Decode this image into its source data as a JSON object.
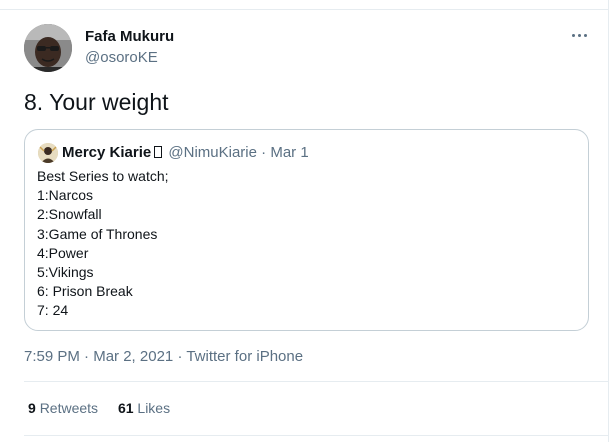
{
  "author": {
    "name": "Fafa Mukuru",
    "handle": "@osoroKE"
  },
  "tweet": {
    "text": "8. Your weight"
  },
  "quoted_tweet": {
    "author_name": "Mercy Kiarie",
    "handle": "@NimuKiarie",
    "separator": "·",
    "date": "Mar 1",
    "lines": [
      "Best Series to watch;",
      "1:Narcos",
      "2:Snowfall",
      "3:Game of Thrones",
      "4:Power",
      "5:Vikings",
      "6: Prison Break",
      "7: 24"
    ]
  },
  "meta": {
    "time": "7:59 PM",
    "separator": "·",
    "date": "Mar 2, 2021",
    "source": "Twitter for iPhone"
  },
  "stats": {
    "retweets_count": "9",
    "retweets_label": "Retweets",
    "likes_count": "61",
    "likes_label": "Likes"
  },
  "icons": {
    "more": "more-options-icon"
  },
  "colors": {
    "text_primary": "#0f1419",
    "text_secondary": "#5b7083",
    "border": "#e6ecf0",
    "card_border": "#c4cfd6"
  }
}
